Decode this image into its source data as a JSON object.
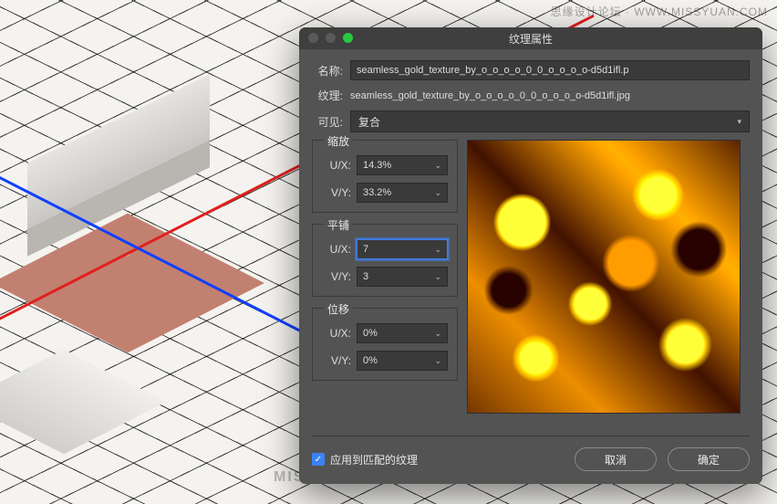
{
  "watermark_top": "思缘设计论坛 · WWW.MISSYUAN.COM",
  "watermark_bot": "MISSYUAN.COM",
  "dialog": {
    "title": "纹理属性",
    "name_label": "名称:",
    "name_value": "seamless_gold_texture_by_o_o_o_o_0_0_o_o_o_o-d5d1ifl.p",
    "texture_label": "纹理:",
    "texture_value": "seamless_gold_texture_by_o_o_o_o_0_0_o_o_o_o-d5d1ifl.jpg",
    "visible_label": "可见:",
    "visible_value": "复合",
    "groups": {
      "scale": {
        "title": "缩放",
        "ux_label": "U/X:",
        "ux_value": "14.3%",
        "vy_label": "V/Y:",
        "vy_value": "33.2%"
      },
      "tile": {
        "title": "平铺",
        "ux_label": "U/X:",
        "ux_value": "7",
        "vy_label": "V/Y:",
        "vy_value": "3"
      },
      "offset": {
        "title": "位移",
        "ux_label": "U/X:",
        "ux_value": "0%",
        "vy_label": "V/Y:",
        "vy_value": "0%"
      }
    },
    "apply_checkbox": "应用到匹配的纹理",
    "cancel": "取消",
    "ok": "确定"
  }
}
